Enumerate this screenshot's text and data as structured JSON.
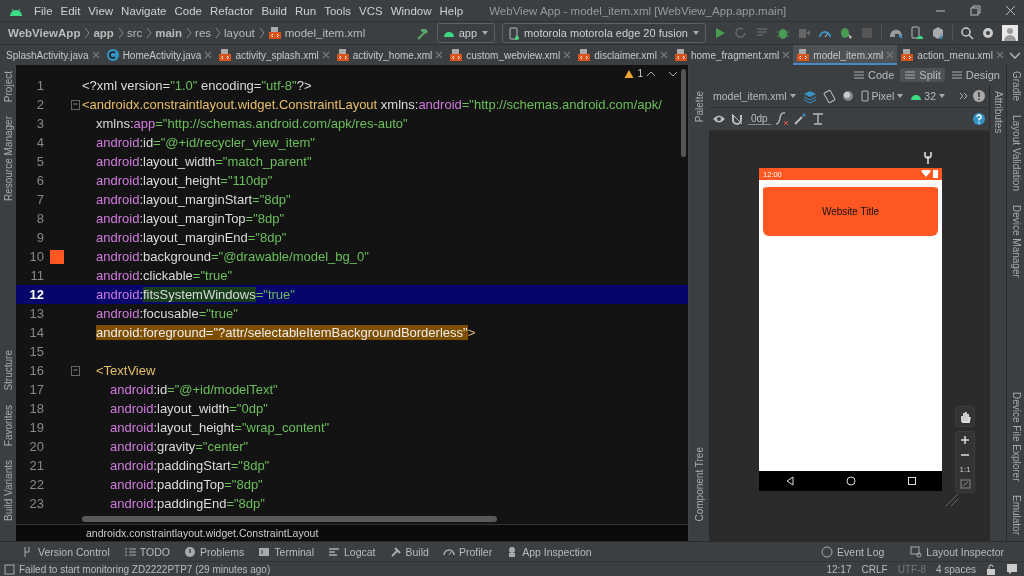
{
  "menu_bar": {
    "items": [
      "File",
      "Edit",
      "View",
      "Navigate",
      "Code",
      "Refactor",
      "Build",
      "Run",
      "Tools",
      "VCS",
      "Window",
      "Help"
    ],
    "title": "WebView App - model_item.xml [WebView_App.app.main]"
  },
  "nav_bar": {
    "breadcrumbs": [
      {
        "text": "WebViewApp",
        "emphasis": true
      },
      {
        "text": "app",
        "emphasis": true
      },
      {
        "text": "src",
        "emphasis": false
      },
      {
        "text": "main",
        "emphasis": true
      },
      {
        "text": "res",
        "emphasis": false
      },
      {
        "text": "layout",
        "emphasis": false
      },
      {
        "text": "model_item.xml",
        "emphasis": false,
        "kind": "xml"
      }
    ],
    "run_config": "app",
    "device": "motorola motorola edge 20 fusion"
  },
  "tabs": [
    {
      "label": "SplashActivity.java",
      "kind": "plain",
      "selected": false
    },
    {
      "label": "HomeActivity.java",
      "kind": "java",
      "selected": false
    },
    {
      "label": "activity_splash.xml",
      "kind": "xml",
      "selected": false
    },
    {
      "label": "activity_home.xml",
      "kind": "xml",
      "selected": false
    },
    {
      "label": "custom_webview.xml",
      "kind": "xml",
      "selected": false
    },
    {
      "label": "disclaimer.xml",
      "kind": "xml",
      "selected": false
    },
    {
      "label": "home_fragment.xml",
      "kind": "xml",
      "selected": false
    },
    {
      "label": "model_item.xml",
      "kind": "xml",
      "selected": true
    },
    {
      "label": "action_menu.xml",
      "kind": "xml",
      "selected": false
    }
  ],
  "left_strip": {
    "top": [
      "Project",
      "Resource Manager"
    ],
    "bottom": [
      "Structure",
      "Favorites",
      "Build Variants"
    ]
  },
  "right_strip": {
    "top": [
      "Gradle",
      "Layout Validation",
      "Device Manager"
    ],
    "bottom": [
      "Device File Explorer",
      "Emulator"
    ]
  },
  "editor": {
    "warnings": "1",
    "lines": [
      {
        "number": "1",
        "selected": false,
        "tokens": [
          {
            "kind": "plain",
            "text": "<?xml version="
          },
          {
            "kind": "value",
            "text": "\"1.0\""
          },
          {
            "kind": "plain",
            "text": " encoding="
          },
          {
            "kind": "value",
            "text": "\"utf-8\""
          },
          {
            "kind": "plain",
            "text": "?>"
          }
        ]
      },
      {
        "number": "2",
        "selected": false,
        "tokens": [
          {
            "kind": "tag",
            "text": "<androidx.constraintlayout.widget.ConstraintLayout"
          },
          {
            "kind": "plain",
            "text": " xmlns:"
          },
          {
            "kind": "ns",
            "text": "android"
          },
          {
            "kind": "value",
            "text": "=\"http://schemas.android.com/apk/"
          }
        ],
        "children": [
          {
            "number": "3",
            "selected": false,
            "tokens": [
              {
                "kind": "plain",
                "text": "xmlns:"
              },
              {
                "kind": "ns",
                "text": "app"
              },
              {
                "kind": "value",
                "text": "=\"http://schemas.android.com/apk/res-auto\""
              }
            ]
          },
          {
            "number": "4",
            "selected": false,
            "tokens": [
              {
                "kind": "ns",
                "text": "android"
              },
              {
                "kind": "plain",
                "text": ":id"
              },
              {
                "kind": "value",
                "text": "=\"@+id/recycler_view_item\""
              }
            ]
          },
          {
            "number": "5",
            "selected": false,
            "tokens": [
              {
                "kind": "ns",
                "text": "android"
              },
              {
                "kind": "plain",
                "text": ":layout_width"
              },
              {
                "kind": "value",
                "text": "=\"match_parent\""
              }
            ]
          },
          {
            "number": "6",
            "selected": false,
            "tokens": [
              {
                "kind": "ns",
                "text": "android"
              },
              {
                "kind": "plain",
                "text": ":layout_height"
              },
              {
                "kind": "value",
                "text": "=\"110dp\""
              }
            ]
          },
          {
            "number": "7",
            "selected": false,
            "tokens": [
              {
                "kind": "ns",
                "text": "android"
              },
              {
                "kind": "plain",
                "text": ":layout_marginStart"
              },
              {
                "kind": "value",
                "text": "=\"8dp\""
              }
            ]
          },
          {
            "number": "8",
            "selected": false,
            "tokens": [
              {
                "kind": "ns",
                "text": "android"
              },
              {
                "kind": "plain",
                "text": ":layout_marginTop"
              },
              {
                "kind": "value",
                "text": "=\"8dp\""
              }
            ]
          },
          {
            "number": "9",
            "selected": false,
            "tokens": [
              {
                "kind": "ns",
                "text": "android"
              },
              {
                "kind": "plain",
                "text": ":layout_marginEnd"
              },
              {
                "kind": "value",
                "text": "=\"8dp\""
              }
            ]
          },
          {
            "number": "10",
            "selected": false,
            "color": "#ff5722",
            "tokens": [
              {
                "kind": "ns",
                "text": "android"
              },
              {
                "kind": "plain",
                "text": ":background"
              },
              {
                "kind": "value",
                "text": "=\"@drawable/model_bg_0\""
              }
            ]
          },
          {
            "number": "11",
            "selected": false,
            "tokens": [
              {
                "kind": "ns",
                "text": "android"
              },
              {
                "kind": "plain",
                "text": ":clickable"
              },
              {
                "kind": "value",
                "text": "=\"true\""
              }
            ]
          },
          {
            "number": "12",
            "selected": true,
            "tokens": [
              {
                "kind": "ns",
                "text": "android"
              },
              {
                "kind": "plain",
                "text": ":"
              },
              {
                "kind": "usage",
                "text": "fitsSystemWindows"
              },
              {
                "kind": "value",
                "text": "=\"true\""
              }
            ]
          },
          {
            "number": "13",
            "selected": false,
            "tokens": [
              {
                "kind": "ns",
                "text": "android"
              },
              {
                "kind": "plain",
                "text": ":focusable"
              },
              {
                "kind": "value",
                "text": "=\"true\""
              }
            ]
          },
          {
            "number": "14",
            "selected": false,
            "tokens": [
              {
                "kind": "search",
                "text": "android:foreground=\"?attr/selectableItemBackgroundBorderless\""
              },
              {
                "kind": "tag",
                "text": ">"
              }
            ]
          },
          {
            "number": "15",
            "selected": false
          },
          {
            "number": "16",
            "selected": false,
            "tokens": [
              {
                "kind": "tag",
                "text": "<TextView"
              }
            ],
            "children": [
              {
                "number": "17",
                "selected": false,
                "tokens": [
                  {
                    "kind": "ns",
                    "text": "android"
                  },
                  {
                    "kind": "plain",
                    "text": ":id"
                  },
                  {
                    "kind": "value",
                    "text": "=\"@+id/modelText\""
                  }
                ]
              },
              {
                "number": "18",
                "selected": false,
                "tokens": [
                  {
                    "kind": "ns",
                    "text": "android"
                  },
                  {
                    "kind": "plain",
                    "text": ":layout_width"
                  },
                  {
                    "kind": "value",
                    "text": "=\"0dp\""
                  }
                ]
              },
              {
                "number": "19",
                "selected": false,
                "tokens": [
                  {
                    "kind": "ns",
                    "text": "android"
                  },
                  {
                    "kind": "plain",
                    "text": ":layout_height"
                  },
                  {
                    "kind": "value",
                    "text": "=\"wrap_content\""
                  }
                ]
              },
              {
                "number": "20",
                "selected": false,
                "tokens": [
                  {
                    "kind": "ns",
                    "text": "android"
                  },
                  {
                    "kind": "plain",
                    "text": ":gravity"
                  },
                  {
                    "kind": "value",
                    "text": "=\"center\""
                  }
                ]
              },
              {
                "number": "21",
                "selected": false,
                "tokens": [
                  {
                    "kind": "ns",
                    "text": "android"
                  },
                  {
                    "kind": "plain",
                    "text": ":paddingStart"
                  },
                  {
                    "kind": "value",
                    "text": "=\"8dp\""
                  }
                ]
              },
              {
                "number": "22",
                "selected": false,
                "tokens": [
                  {
                    "kind": "ns",
                    "text": "android"
                  },
                  {
                    "kind": "plain",
                    "text": ":paddingTop"
                  },
                  {
                    "kind": "value",
                    "text": "=\"8dp\""
                  }
                ]
              },
              {
                "number": "23",
                "selected": false,
                "tokens": [
                  {
                    "kind": "ns",
                    "text": "android"
                  },
                  {
                    "kind": "plain",
                    "text": ":paddingEnd"
                  },
                  {
                    "kind": "value",
                    "text": "=\"8dp\""
                  }
                ]
              }
            ]
          }
        ]
      }
    ],
    "breadcrumb": "androidx.constraintlayout.widget.ConstraintLayout"
  },
  "view_modes": [
    {
      "label": "Code",
      "selected": false
    },
    {
      "label": "Split",
      "selected": true
    },
    {
      "label": "Design",
      "selected": false
    }
  ],
  "design": {
    "palette": "Palette",
    "component_tree": "Component Tree",
    "attributes": "Attributes",
    "file": "model_item.xml",
    "device": "Pixel",
    "api": "32",
    "margin": "0dp",
    "zoom_reset": "1:1",
    "preview": {
      "time": "12:00",
      "card_title": "Website Title"
    }
  },
  "tool_windows": {
    "left": [
      "Version Control",
      "TODO",
      "Problems",
      "Terminal",
      "Logcat",
      "Build",
      "Profiler",
      "App Inspection"
    ],
    "right": [
      "Event Log",
      "Layout Inspector"
    ]
  },
  "status_bar": {
    "message": "Failed to start monitoring ZD2222PTP7 (29 minutes ago)",
    "items": [
      {
        "text": "12:17",
        "disabled": false
      },
      {
        "text": "CRLF",
        "disabled": false
      },
      {
        "text": "UTF-8",
        "disabled": true
      },
      {
        "text": "4 spaces",
        "disabled": false
      }
    ]
  }
}
